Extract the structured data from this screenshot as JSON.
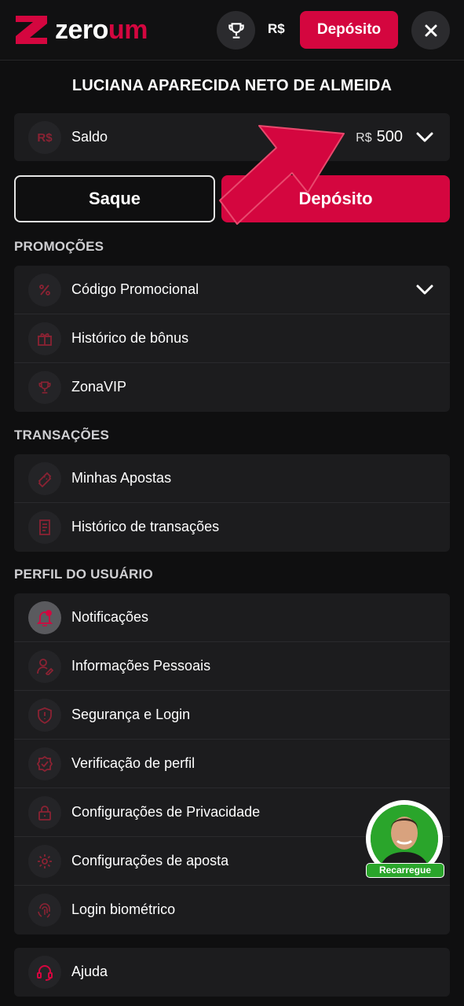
{
  "header": {
    "logo_text_white": "zero",
    "logo_text_red": "um",
    "currency": "R$",
    "deposit_label": "Depósito"
  },
  "user": {
    "name": "LUCIANA APARECIDA NETO DE ALMEIDA"
  },
  "balance": {
    "icon_text": "R$",
    "label": "Saldo",
    "currency": "R$",
    "amount": "500"
  },
  "actions": {
    "withdraw_label": "Saque",
    "deposit_label": "Depósito"
  },
  "sections": {
    "promotions": {
      "title": "PROMOÇÕES",
      "items": [
        {
          "label": "Código Promocional",
          "icon": "percent-icon"
        },
        {
          "label": "Histórico de bônus",
          "icon": "gift-icon"
        },
        {
          "label": "ZonaVIP",
          "icon": "trophy-icon"
        }
      ]
    },
    "transactions": {
      "title": "TRANSAÇÕES",
      "items": [
        {
          "label": "Minhas Apostas",
          "icon": "ticket-icon"
        },
        {
          "label": "Histórico de transações",
          "icon": "receipt-icon"
        }
      ]
    },
    "profile": {
      "title": "PERFIL DO USUÁRIO",
      "items": [
        {
          "label": "Notificações",
          "icon": "bell-icon"
        },
        {
          "label": "Informações Pessoais",
          "icon": "user-edit-icon"
        },
        {
          "label": "Segurança e Login",
          "icon": "shield-icon"
        },
        {
          "label": "Verificação de perfil",
          "icon": "verified-badge-icon"
        },
        {
          "label": "Configurações de Privacidade",
          "icon": "lock-icon"
        },
        {
          "label": "Configurações de aposta",
          "icon": "gear-icon"
        },
        {
          "label": "Login biométrico",
          "icon": "fingerprint-icon"
        }
      ]
    },
    "help": {
      "items": [
        {
          "label": "Ajuda",
          "icon": "headset-icon"
        }
      ]
    }
  },
  "promo_widget": {
    "label": "Recarregue"
  },
  "colors": {
    "accent": "#d4063f",
    "background": "#0f0f10",
    "card": "#1c1c1e",
    "icon_red": "#8a2233"
  }
}
